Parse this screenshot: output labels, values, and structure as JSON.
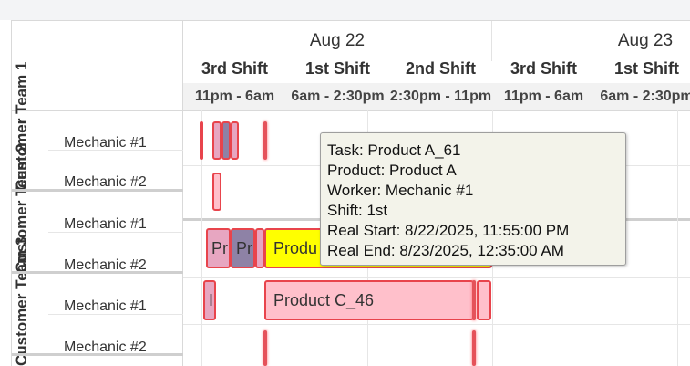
{
  "timeline": {
    "days": [
      {
        "label": "Aug 22"
      },
      {
        "label": "Aug 23"
      }
    ],
    "shifts": [
      {
        "name": "3rd Shift",
        "hours": "11pm - 6am"
      },
      {
        "name": "1st Shift",
        "hours": "6am - 2:30pm"
      },
      {
        "name": "2nd Shift",
        "hours": "2:30pm - 11pm"
      },
      {
        "name": "3rd Shift",
        "hours": "11pm - 6am"
      },
      {
        "name": "1st Shift",
        "hours": "6am - 2:30pm"
      }
    ]
  },
  "teams": [
    {
      "name": "Customer Team 1",
      "workers": [
        "Mechanic #1",
        "Mechanic #2"
      ]
    },
    {
      "name": "Customer Team 2",
      "workers": [
        "Mechanic #1",
        "Mechanic #2"
      ]
    },
    {
      "name": "Customer Team 3",
      "workers": [
        "Mechanic #1",
        "Mechanic #2"
      ]
    }
  ],
  "tasks": {
    "t2_m2_a": "Pr",
    "t2_m2_b": "Pr",
    "t2_m2_c": "Produ",
    "t3_m1_a": "I",
    "t3_m1_b": "Product C_46"
  },
  "tooltip": {
    "task": "Task: Product A_61",
    "product": "Product: Product A",
    "worker": "Worker: Mechanic #1",
    "shift": "Shift: 1st",
    "start": "Real Start: 8/22/2025, 11:55:00 PM",
    "end": "Real End: 8/23/2025, 12:35:00 AM"
  },
  "colors": {
    "task_border": "#e8444c",
    "task_pink": "#ffc0cb",
    "task_purple": "#8e82a6",
    "task_yellow": "#ffff00",
    "now_marker": "#e5525a"
  }
}
